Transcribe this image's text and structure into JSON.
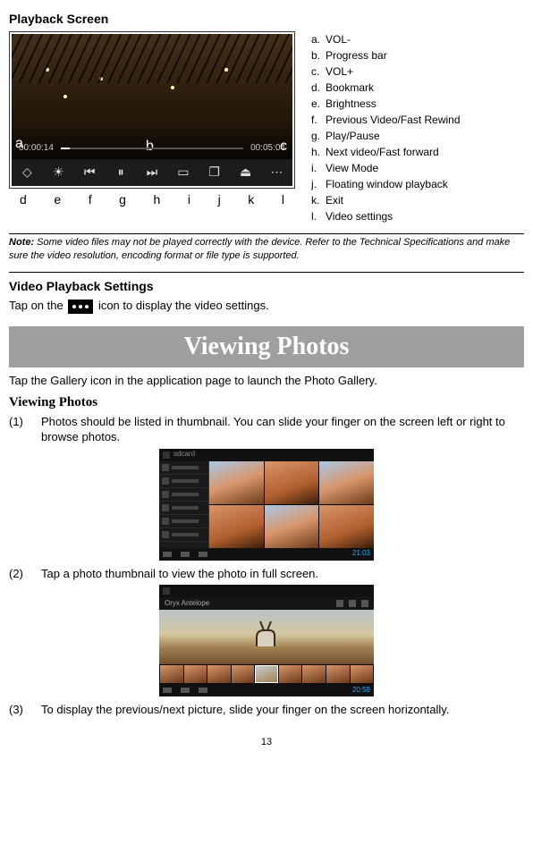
{
  "playback": {
    "title": "Playback Screen",
    "time_left": "00:00:14",
    "time_right": "00:05:04",
    "markers": {
      "a": "a",
      "b": "b",
      "c": "c"
    },
    "letter_row": [
      "d",
      "e",
      "f",
      "g",
      "h",
      "i",
      "j",
      "k",
      "l"
    ],
    "legend": [
      {
        "l": "a.",
        "t": "VOL-"
      },
      {
        "l": "b.",
        "t": "Progress bar"
      },
      {
        "l": "c.",
        "t": "VOL+"
      },
      {
        "l": "d.",
        "t": "Bookmark"
      },
      {
        "l": "e.",
        "t": "Brightness"
      },
      {
        "l": "f.",
        "t": "Previous Video/Fast Rewind"
      },
      {
        "l": "g.",
        "t": "Play/Pause"
      },
      {
        "l": "h.",
        "t": "Next video/Fast forward"
      },
      {
        "l": "i.",
        "t": "View Mode"
      },
      {
        "l": "j.",
        "t": "Floating window playback"
      },
      {
        "l": "k.",
        "t": "Exit"
      },
      {
        "l": "l.",
        "t": "Video settings"
      }
    ]
  },
  "note": {
    "label": "Note:",
    "text": " Some video files may not be played correctly with the device. Refer to the Technical Specifications and make sure the video resolution, encoding format or file type is supported."
  },
  "video_settings": {
    "title": "Video Playback Settings",
    "pre": "Tap on the ",
    "post": " icon to display the video settings."
  },
  "viewing": {
    "banner": "Viewing Photos",
    "intro": "Tap the Gallery icon in the application page to launch the Photo Gallery.",
    "subhead": "Viewing Photos",
    "items": [
      {
        "n": "(1)",
        "t": "Photos should be listed in thumbnail. You can slide your finger on the screen left or right to browse photos."
      },
      {
        "n": "(2)",
        "t": "Tap a photo thumbnail to view the photo in full screen."
      },
      {
        "n": "(3)",
        "t": "To display the previous/next picture, slide your finger on the screen horizontally."
      }
    ],
    "shot1": {
      "sidebar_label": "sdcard",
      "clock": "21:03"
    },
    "shot2": {
      "title": "Oryx Antelope",
      "clock": "20:59"
    }
  },
  "page_number": "13"
}
